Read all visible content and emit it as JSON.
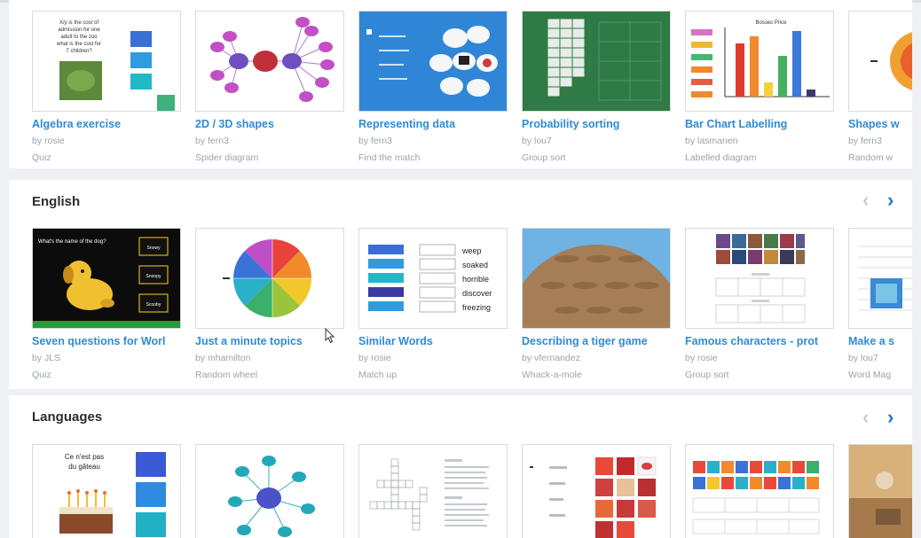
{
  "sections": [
    {
      "title": "",
      "cards": [
        {
          "title": "Algebra exercise",
          "author": "by rosie",
          "type": "Quiz",
          "thumb": "quiz-question",
          "thumb_text": [
            "X/y is the cost of",
            "admission for one",
            "adult to the zoo",
            "what is the cost for",
            "7 children?"
          ]
        },
        {
          "title": "2D / 3D shapes",
          "author": "by fern3",
          "type": "Spider diagram",
          "thumb": "spider-diagram"
        },
        {
          "title": "Representing data",
          "author": "by fern3",
          "type": "Find the match",
          "thumb": "clouds"
        },
        {
          "title": "Probability sorting",
          "author": "by lou7",
          "type": "Group sort",
          "thumb": "green-grid"
        },
        {
          "title": "Bar Chart Labelling",
          "author": "by lasmanen",
          "type": "Labelled diagram",
          "thumb": "bar-chart",
          "thumb_text": [
            "Bosses Price"
          ]
        },
        {
          "title": "Shapes w",
          "author": "by fern3",
          "type": "Random w",
          "thumb": "wheel-partial"
        }
      ]
    },
    {
      "title": "English",
      "cards": [
        {
          "title": "Seven questions for Worl",
          "author": "by JLS",
          "type": "Quiz",
          "thumb": "dog-quiz",
          "thumb_text": [
            "What's the name of the dog?",
            "Snowy",
            "Snoopy",
            "Scooby"
          ]
        },
        {
          "title": "Just a minute topics",
          "author": "by mhamilton",
          "type": "Random wheel",
          "thumb": "color-wheel"
        },
        {
          "title": "Similar Words",
          "author": "by rosie",
          "type": "Match up",
          "thumb": "match-words",
          "thumb_text": [
            "weep",
            "soaked",
            "horrible",
            "discover",
            "freezing"
          ]
        },
        {
          "title": "Describing a tiger game",
          "author": "by vfernandez",
          "type": "Whack-a-mole",
          "thumb": "dirt-holes"
        },
        {
          "title": "Famous characters - prot",
          "author": "by rosie",
          "type": "Group sort",
          "thumb": "photo-grid"
        },
        {
          "title": "Make a s",
          "author": "by lou7",
          "type": "Word Mag",
          "thumb": "lined-paper"
        }
      ]
    },
    {
      "title": "Languages",
      "cards": [
        {
          "title": "",
          "author": "",
          "type": "",
          "thumb": "cake-quiz",
          "thumb_text": [
            "Ce n'est pas",
            "du gâteau"
          ]
        },
        {
          "title": "",
          "author": "",
          "type": "",
          "thumb": "spider-blue"
        },
        {
          "title": "",
          "author": "",
          "type": "",
          "thumb": "crossword"
        },
        {
          "title": "",
          "author": "",
          "type": "",
          "thumb": "pictures-list"
        },
        {
          "title": "",
          "author": "",
          "type": "",
          "thumb": "color-tiles"
        },
        {
          "title": "",
          "author": "",
          "type": "",
          "thumb": "photo-partial"
        }
      ]
    }
  ],
  "nav": {
    "prev": "‹",
    "next": "›"
  },
  "colors": {
    "link": "#2e8bd6",
    "meta": "#9aa3ad",
    "arrow_active": "#1b78c9",
    "arrow_inactive": "#c9ccd1"
  }
}
